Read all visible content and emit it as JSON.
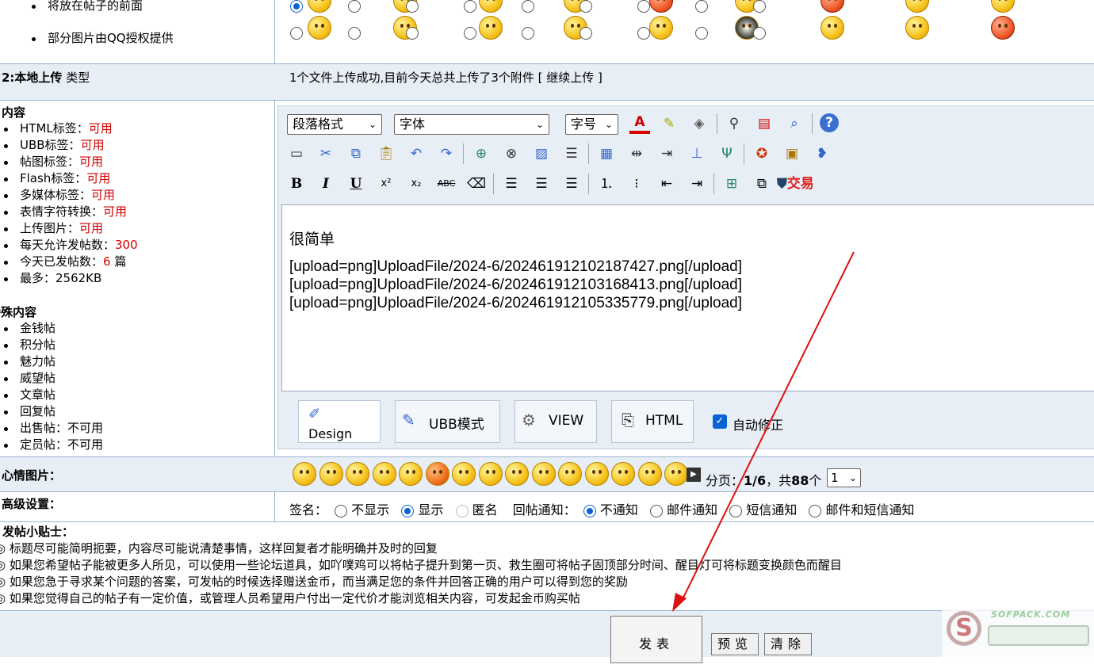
{
  "notes": {
    "items": [
      "将放在帖子的前面",
      "部分图片由QQ授权提供"
    ]
  },
  "upload": {
    "label": "2:本地上传",
    "label_suffix": "类型",
    "status": "1个文件上传成功,目前今天总共上传了3个附件 [ 继续上传 ]"
  },
  "content_rules": {
    "header": "内容",
    "items": [
      {
        "label": "HTML标签：",
        "value": "可用"
      },
      {
        "label": "UBB标签：",
        "value": "可用"
      },
      {
        "label": "帖图标签：",
        "value": "可用"
      },
      {
        "label": "Flash标签：",
        "value": "可用"
      },
      {
        "label": "多媒体标签：",
        "value": "可用"
      },
      {
        "label": "表情字符转换：",
        "value": "可用"
      },
      {
        "label": "上传图片：",
        "value": "可用"
      },
      {
        "label": "每天允许发帖数：",
        "value": "300"
      },
      {
        "label": "今天已发帖数：",
        "value": "6",
        "suffix": "篇"
      },
      {
        "label": "最多：2562KB",
        "value": ""
      }
    ]
  },
  "special": {
    "header": "特殊内容",
    "items": [
      "金钱帖",
      "积分帖",
      "魅力帖",
      "威望帖",
      "文章帖",
      "回复帖",
      "出售帖：不可用",
      "定员帖：不可用"
    ]
  },
  "editor": {
    "paragraph_select": "段落格式",
    "font_select": "字体",
    "size_select": "字号",
    "trade_label": "交易",
    "content_lines": [
      "很简单",
      "",
      "[upload=png]UploadFile/2024-6/202461912102187427.png[/upload]",
      "[upload=png]UploadFile/2024-6/202461912103168413.png[/upload]",
      "[upload=png]UploadFile/2024-6/202461912105335779.png[/upload]"
    ],
    "modes": {
      "design": "Design",
      "ubb": "UBB模式",
      "view": "VIEW",
      "html": "HTML"
    },
    "auto_fix": "自动修正"
  },
  "mood": {
    "label": "心情图片：",
    "pager_prefix": "分页：",
    "page": "1/6",
    "total_prefix": "，共",
    "total": "88",
    "total_suffix": "个",
    "page_select": "1"
  },
  "advanced": {
    "label": "高级设置：",
    "sign_label": "签名：",
    "sign_options": [
      "不显示",
      "显示",
      "匿名"
    ],
    "reply_label": "回帖通知：",
    "reply_options": [
      "不通知",
      "邮件通知",
      "短信通知",
      "邮件和短信通知"
    ]
  },
  "tips": {
    "header": "发帖小贴士：",
    "items": [
      "标题尽可能简明扼要，内容尽可能说清楚事情，这样回复者才能明确并及时的回复",
      "如果您希望帖子能被更多人所见，可以使用一些论坛道具，如吖噗鸡可以将帖子提升到第一页、救生圈可将帖子固顶部分时间、醒目灯可将标题变换颜色而醒目",
      "如果您急于寻求某个问题的答案，可发帖的时候选择赠送金币，而当满足您的条件并回答正确的用户可以得到您的奖励",
      "如果您觉得自己的帖子有一定价值，或管理人员希望用户付出一定代价才能浏览相关内容，可发起金币购买帖"
    ]
  },
  "actions": {
    "submit": "发表",
    "preview": "预览",
    "clear": "清除"
  },
  "watermark": {
    "text": "SOFPACK.COM"
  },
  "colors": {
    "accent_red": "#d40000",
    "band": "#e8eef6",
    "annotation_arrow": "#e01010"
  }
}
